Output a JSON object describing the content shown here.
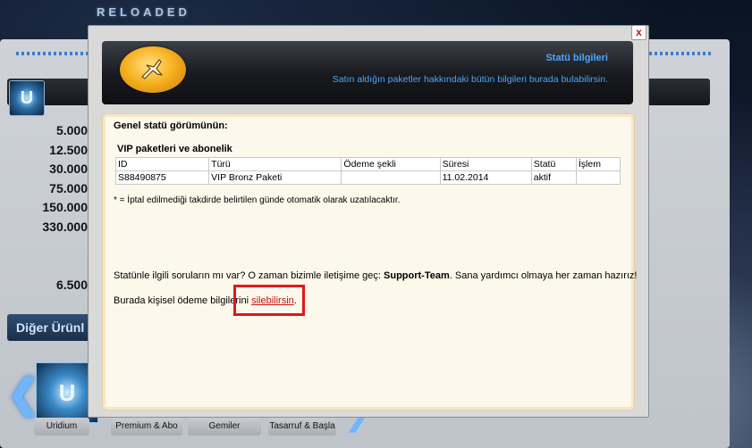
{
  "background": {
    "logo": "RELOADED",
    "amounts": [
      "5.000",
      "12.500",
      "30.000",
      "75.000",
      "150.000",
      "330.000",
      "6.500"
    ],
    "other_products_label": "Diğer Ürünl",
    "emblem": "U",
    "tabs": [
      "Uridium",
      "Premium & Abo",
      "Gemiler",
      "Tasarruf & Başla"
    ]
  },
  "modal": {
    "close_label": "x",
    "header": {
      "title": "Statü bilgileri",
      "subtitle": "Satın aldığın paketler hakkındaki bütün bilgileri burada bulabilirsin."
    },
    "overview_heading": "Genel statü görümünün:",
    "vip_heading": "VIP paketleri ve abonelik",
    "table": {
      "headers": [
        "ID",
        "Türü",
        "Ödeme şekli",
        "Süresi",
        "Statü",
        "İşlem"
      ],
      "rows": [
        [
          "S88490875",
          "VIP Bronz Paketi",
          "",
          "11.02.2014",
          "aktif",
          ""
        ]
      ]
    },
    "note": "* = İptal edilmediği takdirde belirtilen günde otomatik olarak uzatılacaktır.",
    "support": {
      "before": "Statünle ilgili soruların mı var? O zaman bizimle iletişime geç: ",
      "team": "Support-Team",
      "after": ". Sana yardımcı olmaya her zaman hazırız!"
    },
    "payment": {
      "before": "Burada kişisel ödeme bilgilerini ",
      "link": "silebilirsin",
      "after": "."
    }
  },
  "colors": {
    "accent_blue": "#4aa6ff",
    "highlight_red": "#e01818",
    "link_red": "#c41212"
  }
}
